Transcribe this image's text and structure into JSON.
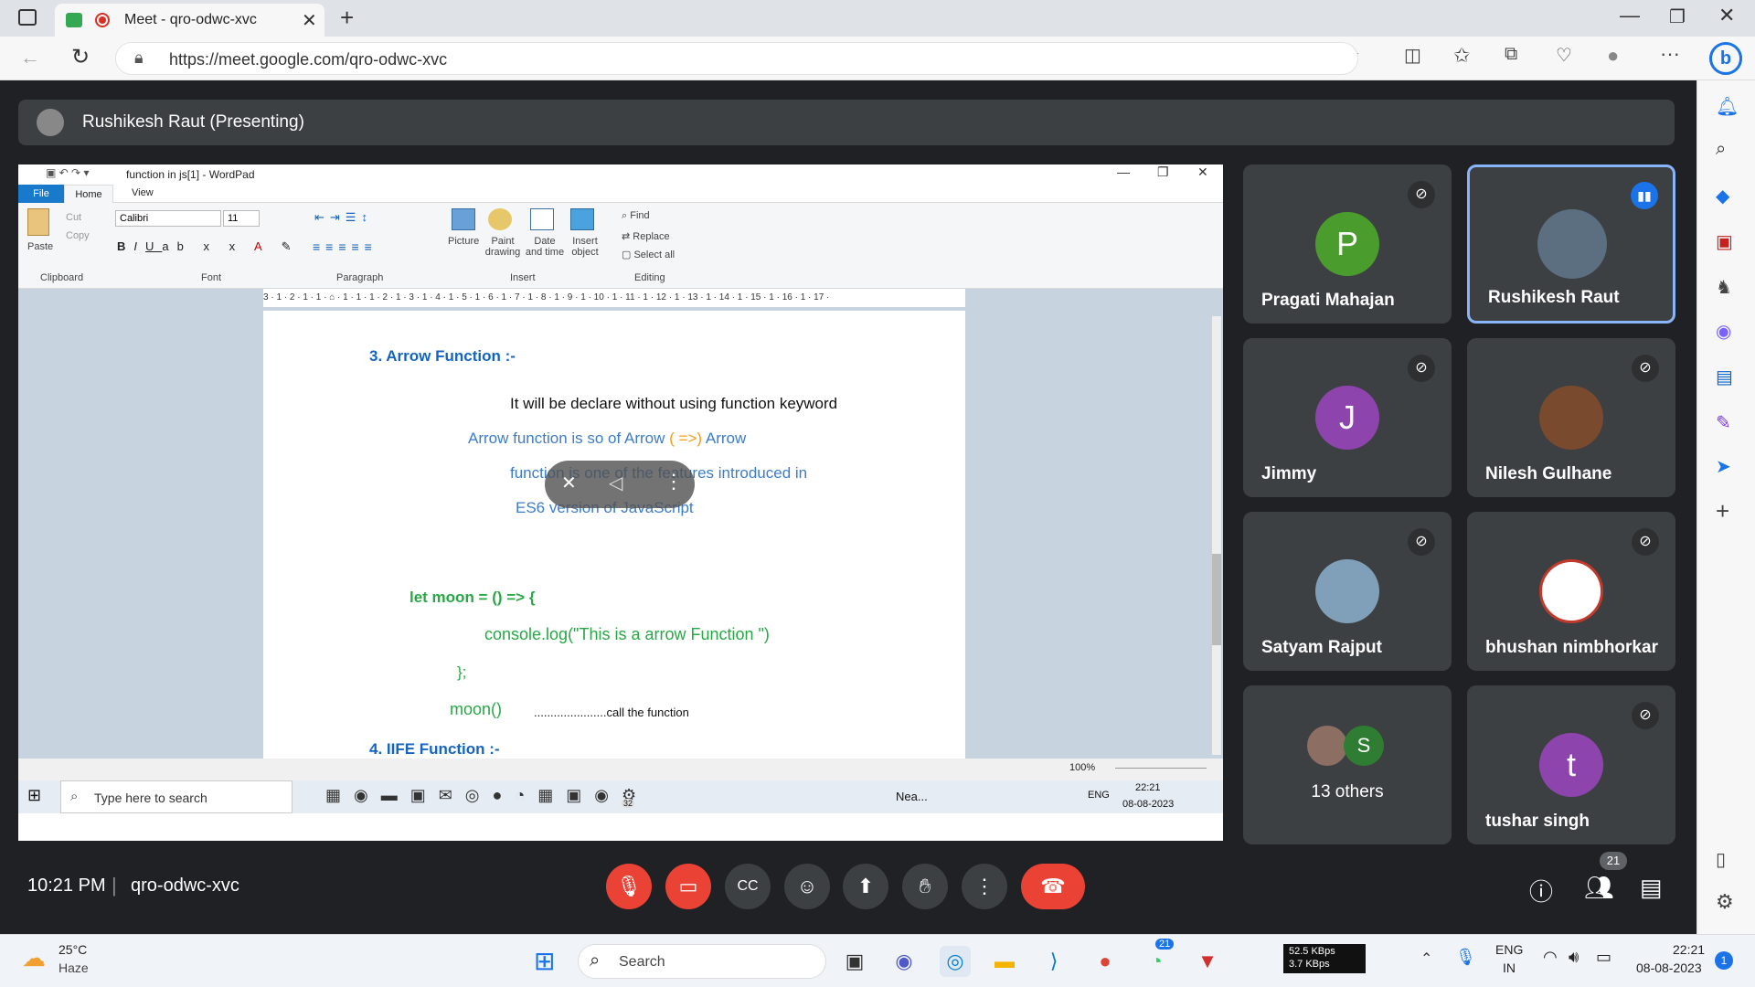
{
  "browser": {
    "tab_title": "Meet - qro-odwc-xvc",
    "url": "https://meet.google.com/qro-odwc-xvc",
    "new_tab_symbol": "+"
  },
  "meet": {
    "presenter_label": "Rushikesh Raut (Presenting)",
    "time": "10:21 PM",
    "meeting_code": "qro-odwc-xvc",
    "participants_count": "21",
    "participants": [
      {
        "name": "Pragati Mahajan",
        "initial": "P",
        "color": "#4a9c2d"
      },
      {
        "name": "Rushikesh Raut"
      },
      {
        "name": "Jimmy",
        "initial": "J",
        "color": "#8e44ad"
      },
      {
        "name": "Nilesh Gulhane"
      },
      {
        "name": "Satyam Rajput"
      },
      {
        "name": "bhushan nimbhorkar"
      },
      {
        "name": "13 others",
        "initial": "S",
        "color": "#2e7d32"
      },
      {
        "name": "tushar singh",
        "initial": "t",
        "color": "#8e44ad"
      }
    ]
  },
  "wordpad": {
    "title": "function in js[1] - WordPad",
    "tabs": [
      "File",
      "Home",
      "View"
    ],
    "font_name": "Calibri",
    "font_size": "11",
    "groups": [
      "Clipboard",
      "Font",
      "Paragraph",
      "Insert",
      "Editing"
    ],
    "clipboard": {
      "paste": "Paste",
      "cut": "Cut",
      "copy": "Copy"
    },
    "insert": {
      "picture": "Picture",
      "paint": "Paint drawing",
      "datetime": "Date and time",
      "object": "Insert object"
    },
    "editing": {
      "find": "Find",
      "replace": "Replace",
      "select_all": "Select all"
    },
    "zoom": "100%",
    "ruler": "3 · 1 · 2 · 1 · 1 · ⌂ · 1 · 1 · 1 · 2 · 1 · 3 · 1 · 4 · 1 · 5 · 1 · 6 · 1 · 7 · 1 · 8 · 1 · 9 · 1 · 10 · 1 · 11 · 1 · 12 · 1 · 13 · 1 · 14 · 1 · 15 · 1 · 16 · 1 · 17 ·",
    "doc": {
      "h3": "3. Arrow Function :-",
      "line1": "It will be declare without using function keyword",
      "line2": "Arrow function is so of Arrow",
      "line2b": "( =>)",
      "line2c": "Arrow",
      "line3": "function is one of the features introduced in",
      "line4": "ES6 version of JavaScript",
      "code1": "let moon = () => {",
      "code2": "console.log(\"This is a arrow Function \")",
      "code3": "};",
      "code4": "moon()",
      "code4_note": "......................call the function",
      "h4": "4. IIFE Function :-"
    }
  },
  "inner_taskbar": {
    "search_placeholder": "Type here to search",
    "weather": "Nea...",
    "lang": "ENG",
    "time": "22:21",
    "date": "08-08-2023",
    "whatsapp_badge": "32"
  },
  "taskbar": {
    "temp": "25°C",
    "weather": "Haze",
    "search": "Search",
    "net_up": "52.5 KBps",
    "net_down": "3.7 KBps",
    "lang1": "ENG",
    "lang2": "IN",
    "time": "22:21",
    "date": "08-08-2023",
    "whatsapp_badge": "21",
    "notif": "1"
  }
}
